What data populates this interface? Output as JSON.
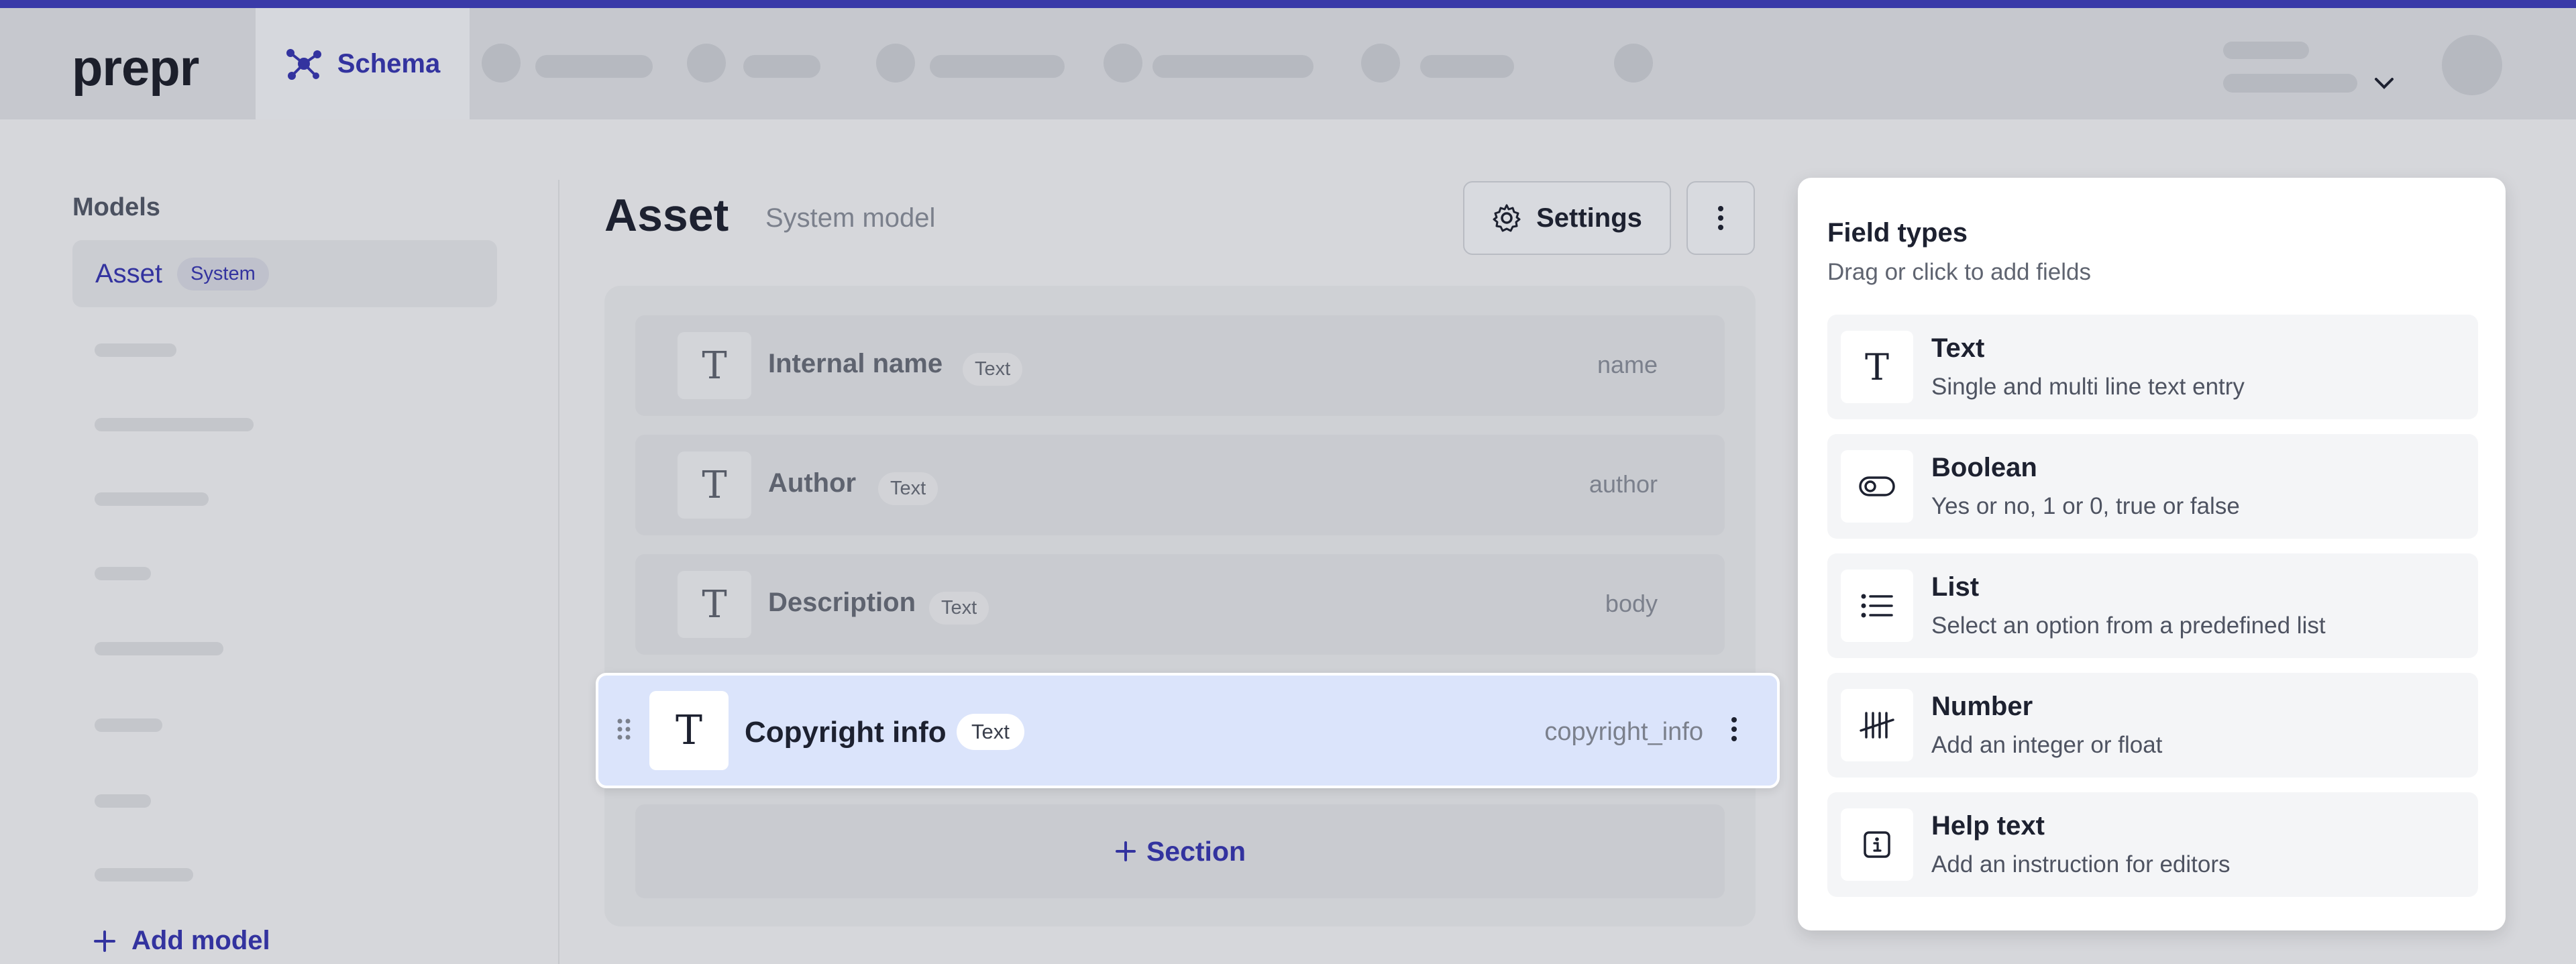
{
  "app": {
    "logo": "prepr",
    "active_tab": "Schema"
  },
  "sidebar": {
    "title": "Models",
    "selected_model": {
      "label": "Asset",
      "badge": "System"
    },
    "add_model_label": "Add model"
  },
  "main": {
    "model_title": "Asset",
    "model_subtitle": "System model",
    "settings_label": "Settings",
    "fields": [
      {
        "name": "Internal name",
        "type": "Text",
        "api_id": "name"
      },
      {
        "name": "Author",
        "type": "Text",
        "api_id": "author"
      },
      {
        "name": "Description",
        "type": "Text",
        "api_id": "body"
      }
    ],
    "dragging_field": {
      "name": "Copyright info",
      "type": "Text",
      "api_id": "copyright_info"
    },
    "add_section_label": "Section"
  },
  "field_types": {
    "title": "Field types",
    "subtitle": "Drag or click to add fields",
    "items": [
      {
        "name": "Text",
        "desc": "Single and multi line text entry",
        "icon": "text-icon"
      },
      {
        "name": "Boolean",
        "desc": "Yes or no, 1 or 0, true or false",
        "icon": "toggle-icon"
      },
      {
        "name": "List",
        "desc": "Select an option from a predefined list",
        "icon": "list-icon"
      },
      {
        "name": "Number",
        "desc": "Add an integer or float",
        "icon": "tally-icon"
      },
      {
        "name": "Help text",
        "desc": "Add an instruction for editors",
        "icon": "info-icon"
      }
    ]
  },
  "colors": {
    "accent": "#33339f",
    "top_line": "#3a3aa8",
    "drag_highlight": "#dbe4fb"
  }
}
